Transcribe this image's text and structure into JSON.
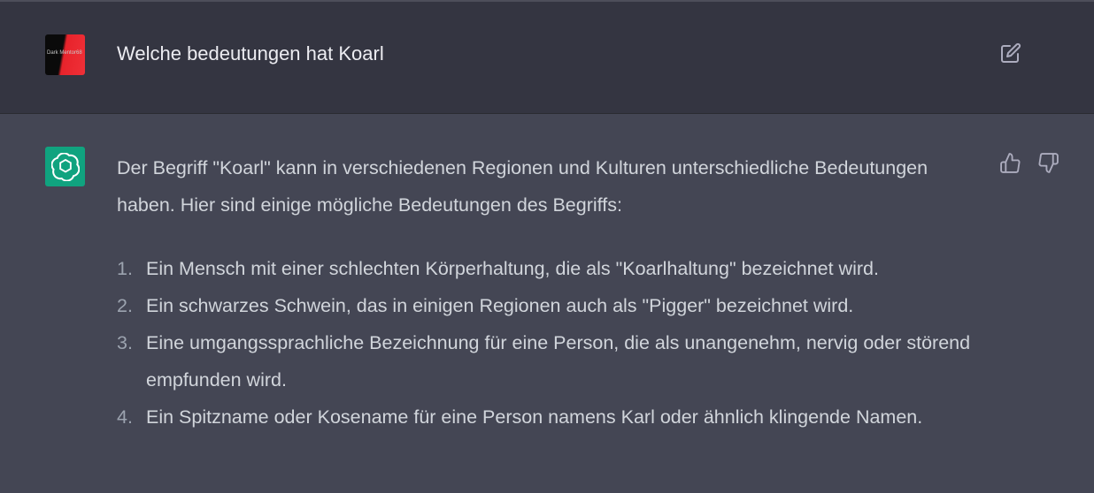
{
  "user_message": {
    "avatar_logo_text": "Dark Mentor68",
    "text": "Welche bedeutungen hat Koarl",
    "edit_icon": "edit-icon"
  },
  "assistant_message": {
    "avatar_icon": "openai-logo-icon",
    "intro": "Der Begriff \"Koarl\" kann in verschiedenen Regionen und Kulturen unterschiedliche Bedeutungen haben. Hier sind einige mögliche Bedeutungen des Begriffs:",
    "items": [
      {
        "number": "1.",
        "text": "Ein Mensch mit einer schlechten Körperhaltung, die als \"Koarlhaltung\" bezeichnet wird."
      },
      {
        "number": "2.",
        "text": "Ein schwarzes Schwein, das in einigen Regionen auch als \"Pigger\" bezeichnet wird."
      },
      {
        "number": "3.",
        "text": "Eine umgangssprachliche Bezeichnung für eine Person, die als unangenehm, nervig oder störend empfunden wird."
      },
      {
        "number": "4.",
        "text": "Ein Spitzname oder Kosename für eine Person namens Karl oder ähnlich klingende Namen."
      }
    ],
    "feedback_icons": [
      "thumbs-up-icon",
      "thumbs-down-icon"
    ]
  },
  "colors": {
    "user_row_bg": "#343541",
    "assistant_row_bg": "#444654",
    "text": "#ececf1",
    "bot_avatar": "#10a37f",
    "icon": "#acacbe"
  }
}
